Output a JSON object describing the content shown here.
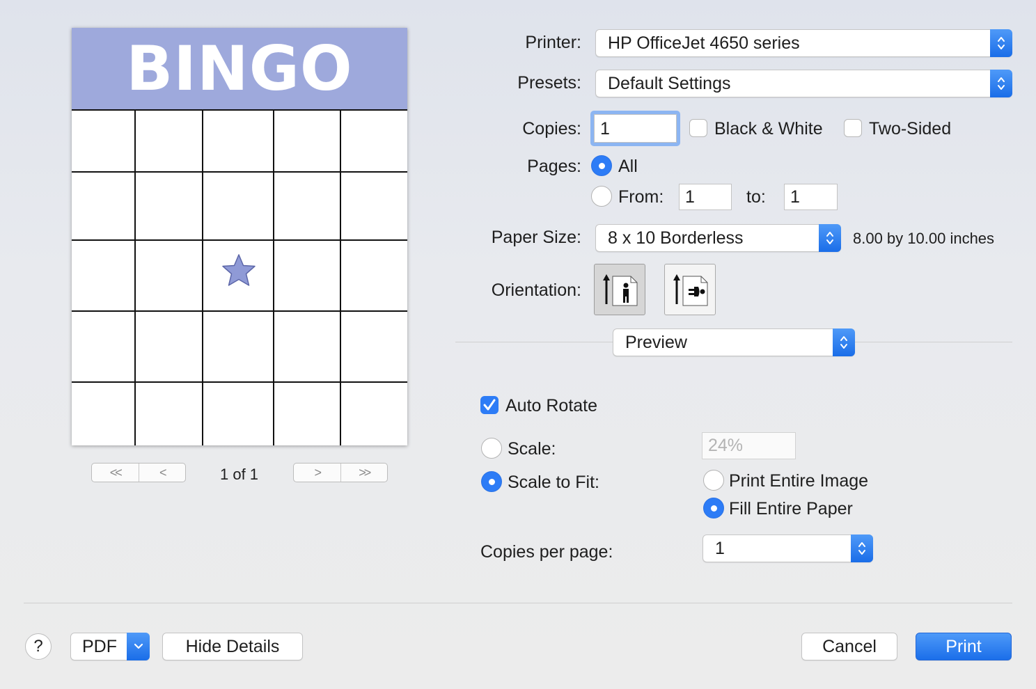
{
  "preview": {
    "title": "BINGO",
    "free_space_icon": "star-icon",
    "colors": {
      "header": "#9ea9dc",
      "star": "#8f9ad6"
    },
    "page_indicator": "1 of 1",
    "nav": {
      "first": "<<",
      "prev": "<",
      "next": ">",
      "last": ">>"
    }
  },
  "printer": {
    "label": "Printer:",
    "value": "HP OfficeJet 4650 series"
  },
  "presets": {
    "label": "Presets:",
    "value": "Default Settings"
  },
  "copies": {
    "label": "Copies:",
    "value": "1",
    "black_white": {
      "label": "Black & White",
      "checked": false
    },
    "two_sided": {
      "label": "Two-Sided",
      "checked": false
    }
  },
  "pages": {
    "label": "Pages:",
    "all_label": "All",
    "from_label": "From:",
    "from_value": "1",
    "to_label": "to:",
    "to_value": "1",
    "selected": "all"
  },
  "paper_size": {
    "label": "Paper Size:",
    "value": "8 x 10 Borderless",
    "dimensions": "8.00 by 10.00 inches"
  },
  "orientation": {
    "label": "Orientation:",
    "options": [
      "portrait-icon",
      "landscape-icon"
    ],
    "selected": "portrait"
  },
  "section_popup": {
    "value": "Preview"
  },
  "auto_rotate": {
    "label": "Auto Rotate",
    "checked": true
  },
  "scale": {
    "label": "Scale:",
    "value": "24%"
  },
  "scale_to_fit": {
    "label": "Scale to Fit:",
    "selected": true,
    "print_entire_image": "Print Entire Image",
    "fill_entire_paper": "Fill Entire Paper",
    "fit_choice": "fill"
  },
  "copies_per_page": {
    "label": "Copies per page:",
    "value": "1"
  },
  "footer": {
    "help": "?",
    "pdf": "PDF",
    "hide_details": "Hide Details",
    "cancel": "Cancel",
    "print": "Print"
  },
  "accent_color": "#2d7cf6"
}
